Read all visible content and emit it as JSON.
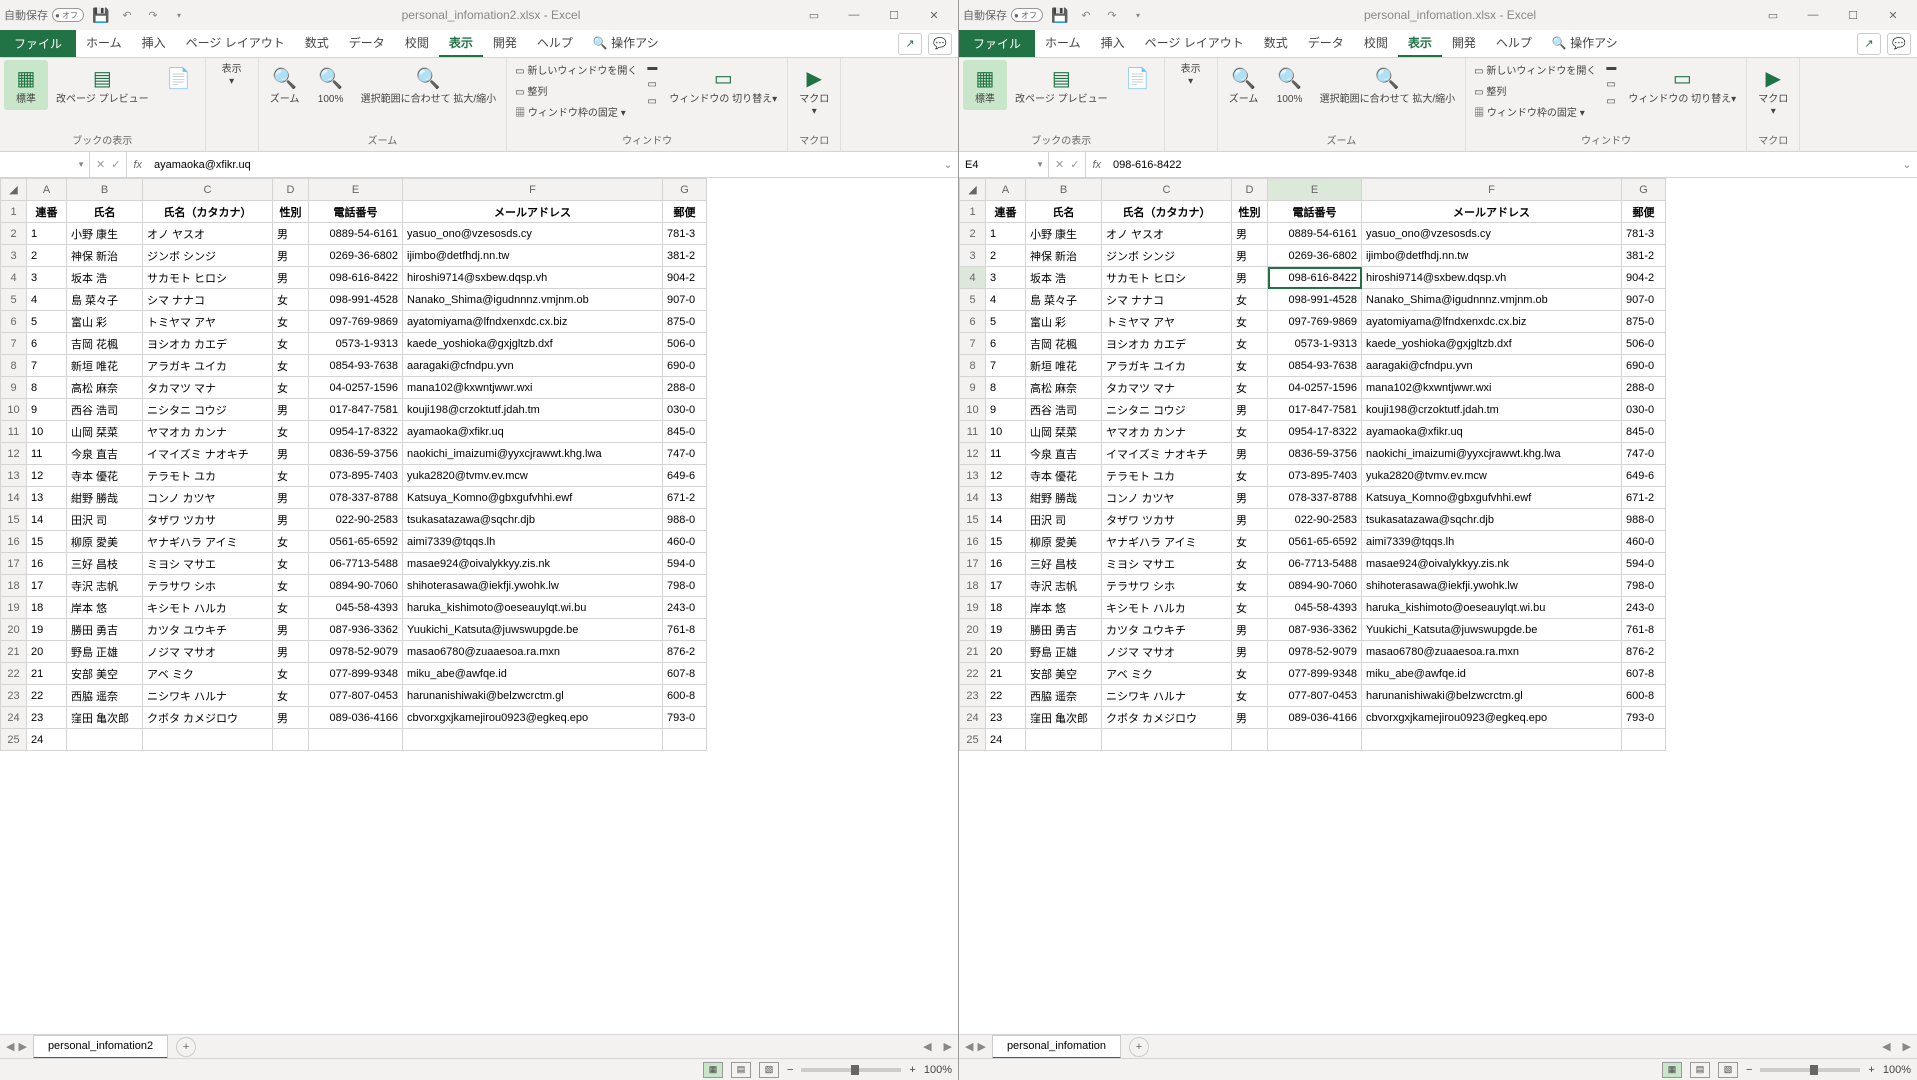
{
  "panes": [
    {
      "title": "personal_infomation2.xlsx - Excel",
      "autosave_label": "自動保存",
      "autosave_state": "オフ",
      "namebox": "",
      "formula": "ayamaoka@xfikr.uq",
      "sheet_name": "personal_infomation2",
      "active_cell": null,
      "selected_row": null
    },
    {
      "title": "personal_infomation.xlsx - Excel",
      "autosave_label": "自動保存",
      "autosave_state": "オフ",
      "namebox": "E4",
      "formula": "098-616-8422",
      "sheet_name": "personal_infomation",
      "active_cell": "E4",
      "selected_row": 4
    }
  ],
  "tabs": {
    "file": "ファイル",
    "list": [
      "ホーム",
      "挿入",
      "ページ レイアウト",
      "数式",
      "データ",
      "校閲",
      "表示",
      "開発",
      "ヘルプ"
    ],
    "active": "表示",
    "search": "操作アシ"
  },
  "ribbon": {
    "g_workbook_views": "ブックの表示",
    "normal": "標準",
    "page_break": "改ページ プレビュー",
    "page_layout_ic": "",
    "show": "表示",
    "g_zoom": "ズーム",
    "zoom": "ズーム",
    "hundred": "100%",
    "fit_selection": "選択範囲に合わせて 拡大/縮小",
    "g_window": "ウィンドウ",
    "new_window": "新しいウィンドウを開く",
    "arrange": "整列",
    "freeze": "ウィンドウ枠の固定",
    "switch": "ウィンドウの 切り替え",
    "g_macro": "マクロ",
    "macro": "マクロ"
  },
  "headers": [
    "連番",
    "氏名",
    "氏名（カタカナ）",
    "性別",
    "電話番号",
    "メールアドレス",
    "郵便"
  ],
  "cols": [
    "A",
    "B",
    "C",
    "D",
    "E",
    "F",
    "G"
  ],
  "rows": [
    [
      "1",
      "小野 康生",
      "オノ ヤスオ",
      "男",
      "0889-54-6161",
      "yasuo_ono@vzesosds.cy",
      "781-3"
    ],
    [
      "2",
      "神保 新治",
      "ジンボ シンジ",
      "男",
      "0269-36-6802",
      "ijimbo@detfhdj.nn.tw",
      "381-2"
    ],
    [
      "3",
      "坂本 浩",
      "サカモト ヒロシ",
      "男",
      "098-616-8422",
      "hiroshi9714@sxbew.dqsp.vh",
      "904-2"
    ],
    [
      "4",
      "島 菜々子",
      "シマ ナナコ",
      "女",
      "098-991-4528",
      "Nanako_Shima@igudnnnz.vmjnm.ob",
      "907-0"
    ],
    [
      "5",
      "富山 彩",
      "トミヤマ アヤ",
      "女",
      "097-769-9869",
      "ayatomiyama@lfndxenxdc.cx.biz",
      "875-0"
    ],
    [
      "6",
      "吉岡 花楓",
      "ヨシオカ カエデ",
      "女",
      "0573-1-9313",
      "kaede_yoshioka@gxjgltzb.dxf",
      "506-0"
    ],
    [
      "7",
      "新垣 唯花",
      "アラガキ ユイカ",
      "女",
      "0854-93-7638",
      "aaragaki@cfndpu.yvn",
      "690-0"
    ],
    [
      "8",
      "高松 麻奈",
      "タカマツ マナ",
      "女",
      "04-0257-1596",
      "mana102@kxwntjwwr.wxi",
      "288-0"
    ],
    [
      "9",
      "西谷 浩司",
      "ニシタニ コウジ",
      "男",
      "017-847-7581",
      "kouji198@crzoktutf.jdah.tm",
      "030-0"
    ],
    [
      "10",
      "山岡 栞菜",
      "ヤマオカ カンナ",
      "女",
      "0954-17-8322",
      "ayamaoka@xfikr.uq",
      "845-0"
    ],
    [
      "11",
      "今泉 直吉",
      "イマイズミ ナオキチ",
      "男",
      "0836-59-3756",
      "naokichi_imaizumi@yyxcjrawwt.khg.lwa",
      "747-0"
    ],
    [
      "12",
      "寺本 優花",
      "テラモト ユカ",
      "女",
      "073-895-7403",
      "yuka2820@tvmv.ev.mcw",
      "649-6"
    ],
    [
      "13",
      "紺野 勝哉",
      "コンノ カツヤ",
      "男",
      "078-337-8788",
      "Katsuya_Komno@gbxgufvhhi.ewf",
      "671-2"
    ],
    [
      "14",
      "田沢 司",
      "タザワ ツカサ",
      "男",
      "022-90-2583",
      "tsukasatazawa@sqchr.djb",
      "988-0"
    ],
    [
      "15",
      "柳原 愛美",
      "ヤナギハラ アイミ",
      "女",
      "0561-65-6592",
      "aimi7339@tqqs.lh",
      "460-0"
    ],
    [
      "16",
      "三好 昌枝",
      "ミヨシ マサエ",
      "女",
      "06-7713-5488",
      "masae924@oivalykkyy.zis.nk",
      "594-0"
    ],
    [
      "17",
      "寺沢 志帆",
      "テラサワ シホ",
      "女",
      "0894-90-7060",
      "shihoterasawa@iekfji.ywohk.lw",
      "798-0"
    ],
    [
      "18",
      "岸本 悠",
      "キシモト ハルカ",
      "女",
      "045-58-4393",
      "haruka_kishimoto@oeseauylqt.wi.bu",
      "243-0"
    ],
    [
      "19",
      "勝田 勇吉",
      "カツタ ユウキチ",
      "男",
      "087-936-3362",
      "Yuukichi_Katsuta@juwswupgde.be",
      "761-8"
    ],
    [
      "20",
      "野島 正雄",
      "ノジマ マサオ",
      "男",
      "0978-52-9079",
      "masao6780@zuaaesoa.ra.mxn",
      "876-2"
    ],
    [
      "21",
      "安部 美空",
      "アベ ミク",
      "女",
      "077-899-9348",
      "miku_abe@awfqe.id",
      "607-8"
    ],
    [
      "22",
      "西脇 遥奈",
      "ニシワキ ハルナ",
      "女",
      "077-807-0453",
      "harunanishiwaki@belzwcrctm.gl",
      "600-8"
    ],
    [
      "23",
      "窪田 亀次郎",
      "クボタ カメジロウ",
      "男",
      "089-036-4166",
      "cbvorxgxjkamejirou0923@egkeq.epo",
      "793-0"
    ],
    [
      "24",
      "",
      "",
      "",
      "",
      "",
      ""
    ]
  ],
  "status": {
    "zoom": "100%"
  }
}
